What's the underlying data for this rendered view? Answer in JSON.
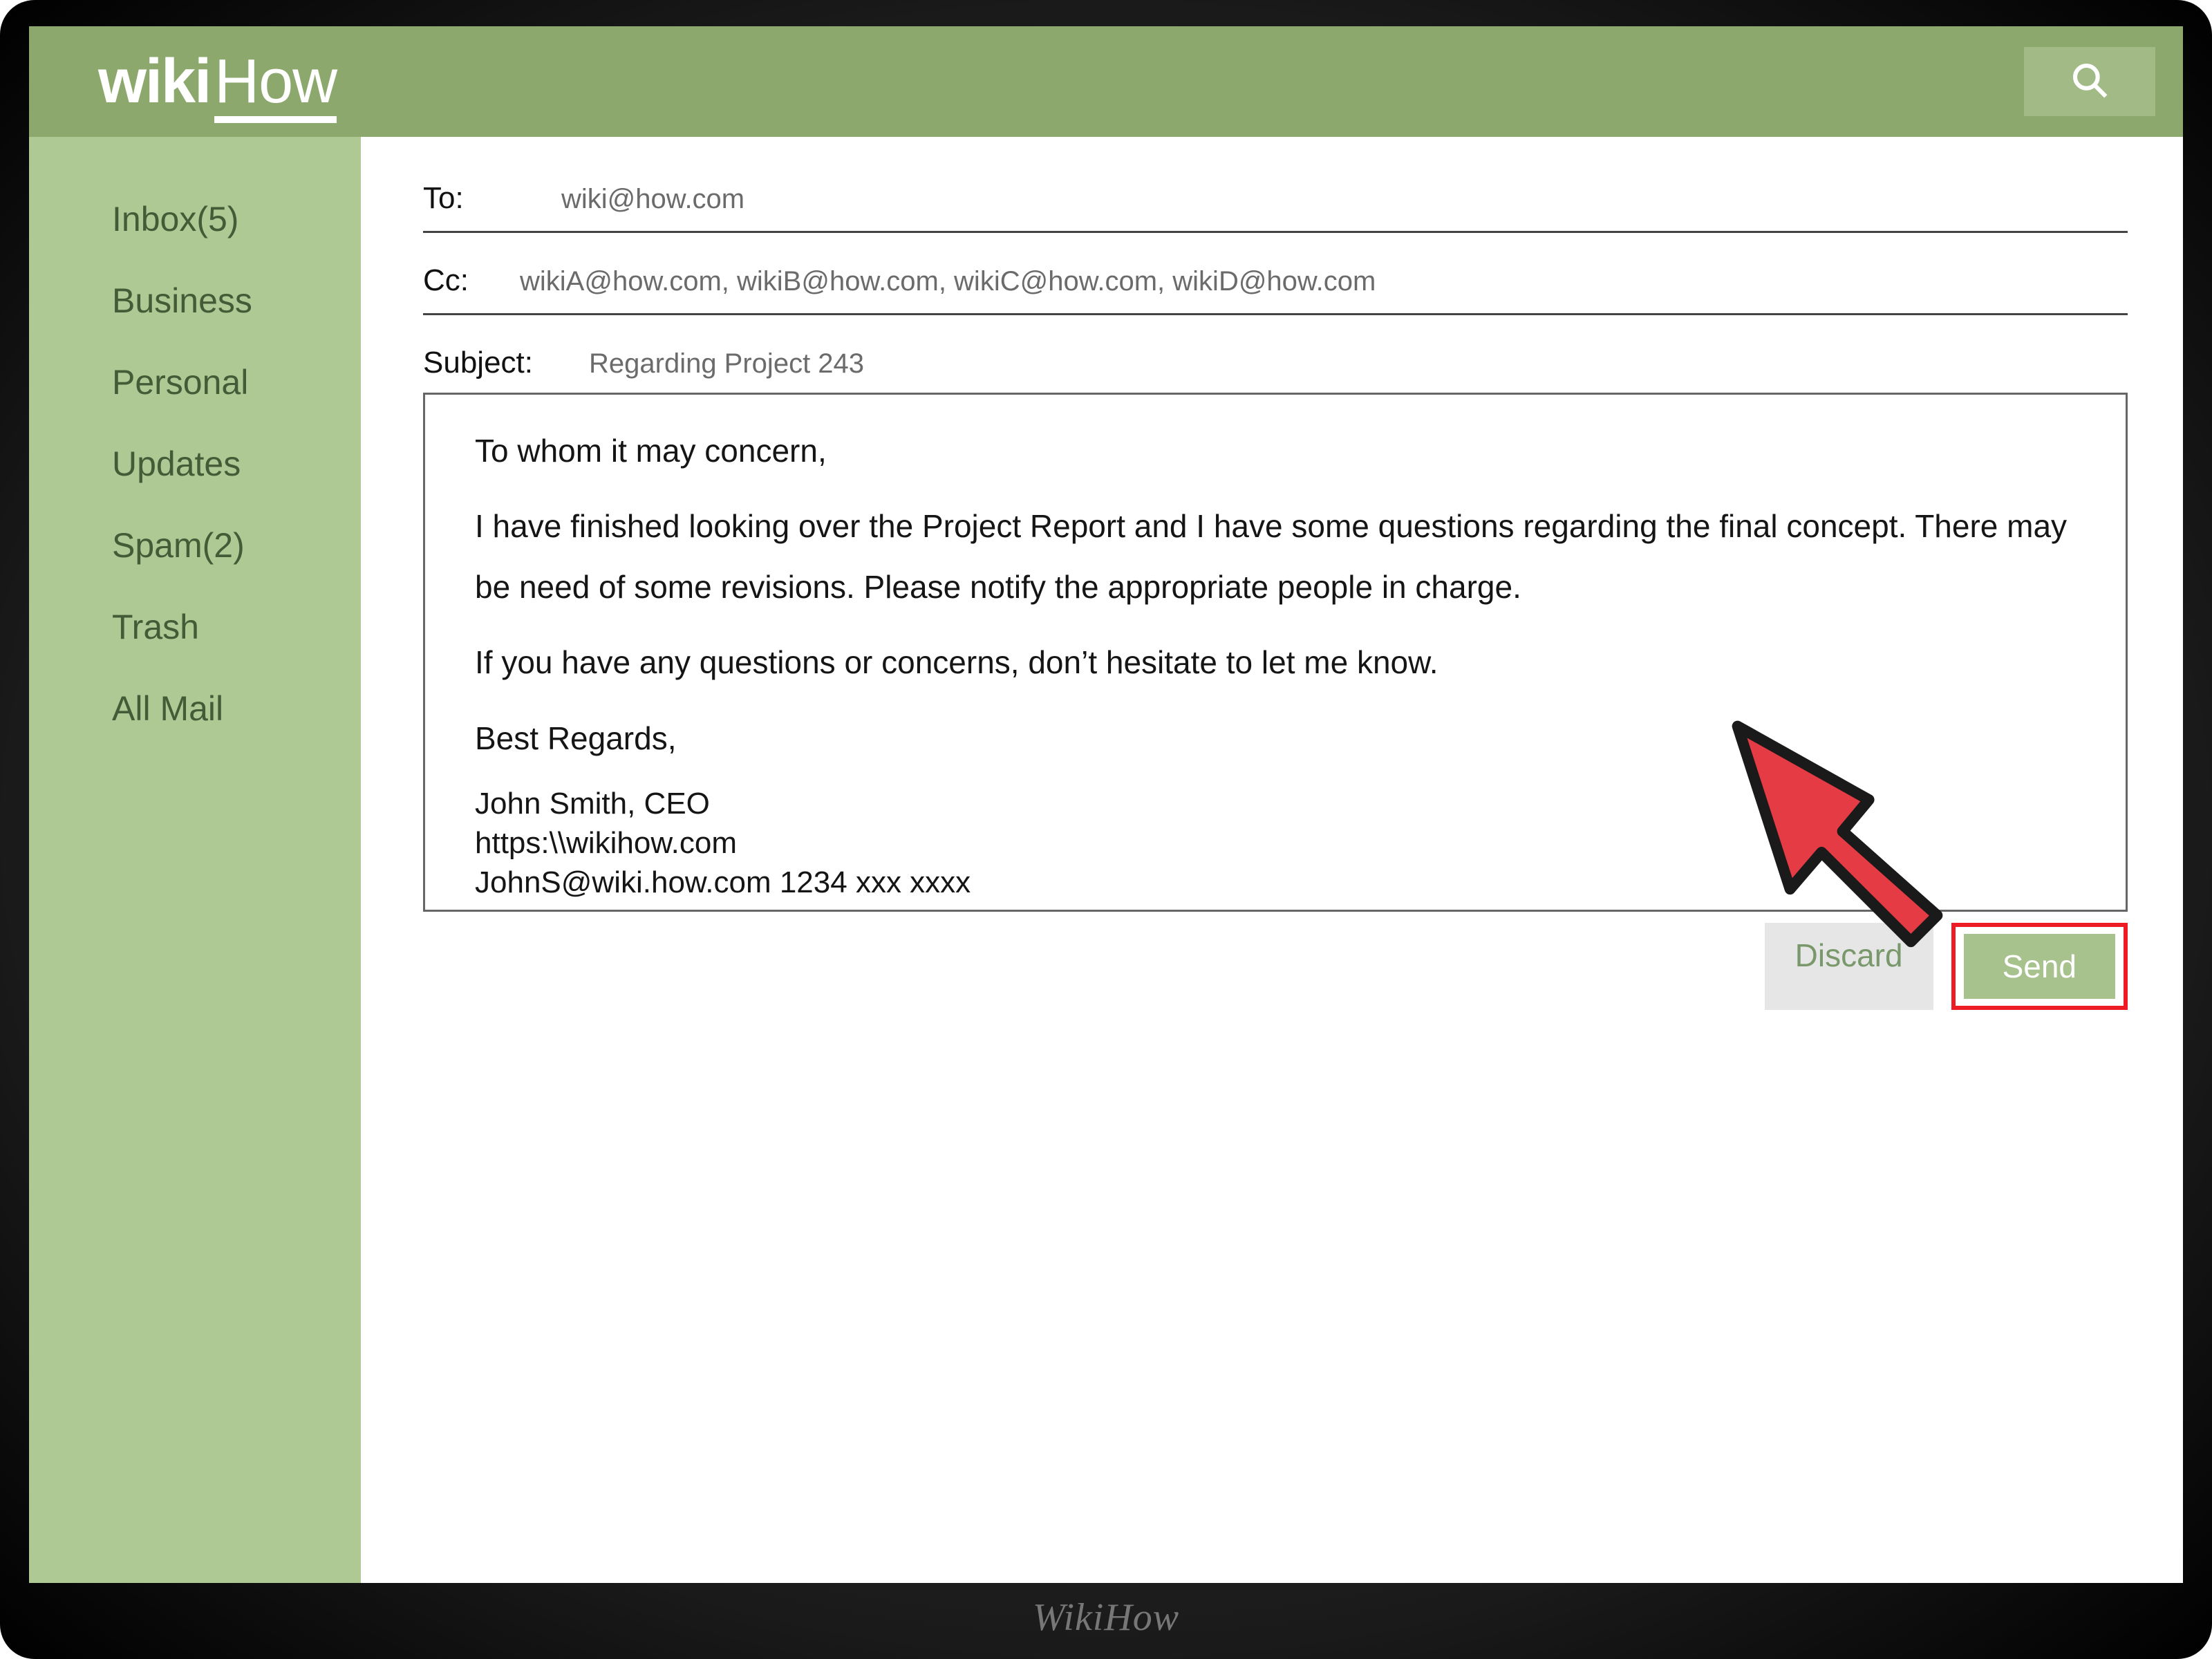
{
  "brand": {
    "wiki": "wiki",
    "how": "How",
    "frame": "WikiHow"
  },
  "sidebar": {
    "items": [
      {
        "label": "Inbox(5)"
      },
      {
        "label": "Business"
      },
      {
        "label": "Personal"
      },
      {
        "label": "Updates"
      },
      {
        "label": "Spam(2)"
      },
      {
        "label": "Trash"
      },
      {
        "label": "All Mail"
      }
    ]
  },
  "compose": {
    "to_label": "To:",
    "to_value": "wiki@how.com",
    "cc_label": "Cc:",
    "cc_value": "wikiA@how.com, wikiB@how.com, wikiC@how.com, wikiD@how.com",
    "subject_label": "Subject:",
    "subject_value": "Regarding Project 243",
    "body": {
      "greeting": "To whom it may concern,",
      "para1": "I have finished looking over the Project Report and I have some questions regarding the final concept. There may be need of some revisions. Please notify the appropriate people in charge.",
      "para2": "If you have any questions or concerns, don’t hesitate to let me know.",
      "closing": "Best Regards,",
      "sig_name": "John Smith, CEO",
      "sig_url": "https:\\\\wikihow.com",
      "sig_contact": "JohnS@wiki.how.com  1234 xxx xxxx"
    },
    "discard_label": "Discard",
    "send_label": "Send"
  }
}
